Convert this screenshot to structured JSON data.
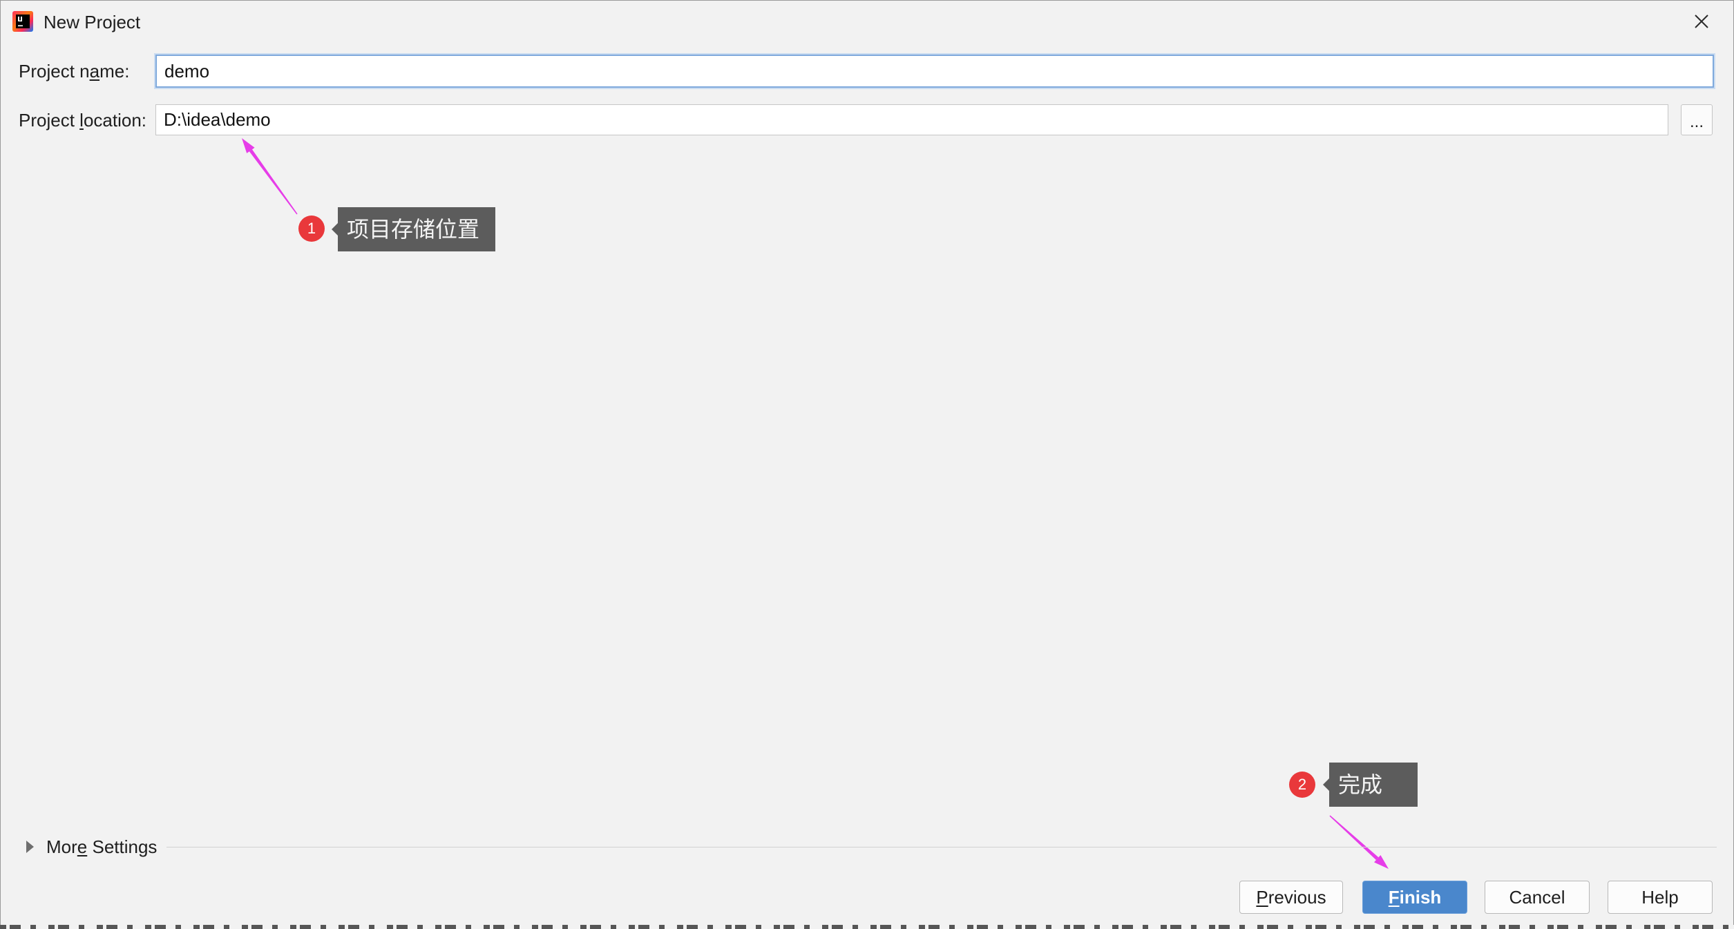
{
  "window": {
    "title": "New Project",
    "icon": "intellij-idea-icon",
    "close_icon": "close-icon"
  },
  "form": {
    "name": {
      "label": "Project name:",
      "mnemonic": "a",
      "value": "demo",
      "focused": true
    },
    "location": {
      "label": "Project location:",
      "mnemonic": "l",
      "value": "D:\\idea\\demo",
      "browse_label": "..."
    }
  },
  "annotations": [
    {
      "number": "1",
      "text": "项目存储位置"
    },
    {
      "number": "2",
      "text": "完成"
    }
  ],
  "more_settings": {
    "label": "More Settings",
    "mnemonic": "e",
    "expanded": false,
    "icon": "expand-triangle-icon"
  },
  "buttons": {
    "previous": {
      "label": "Previous",
      "mnemonic": "P"
    },
    "finish": {
      "label": "Finish",
      "mnemonic": "F",
      "default": true
    },
    "cancel": {
      "label": "Cancel"
    },
    "help": {
      "label": "Help"
    }
  },
  "colors": {
    "window_bg": "#f2f2f2",
    "accent": "#4a87cc",
    "focus_border": "#7fa9dc",
    "annotation_box": "#5c5c5c",
    "annotation_marker": "#e9383b",
    "arrow": "#e63de8"
  }
}
